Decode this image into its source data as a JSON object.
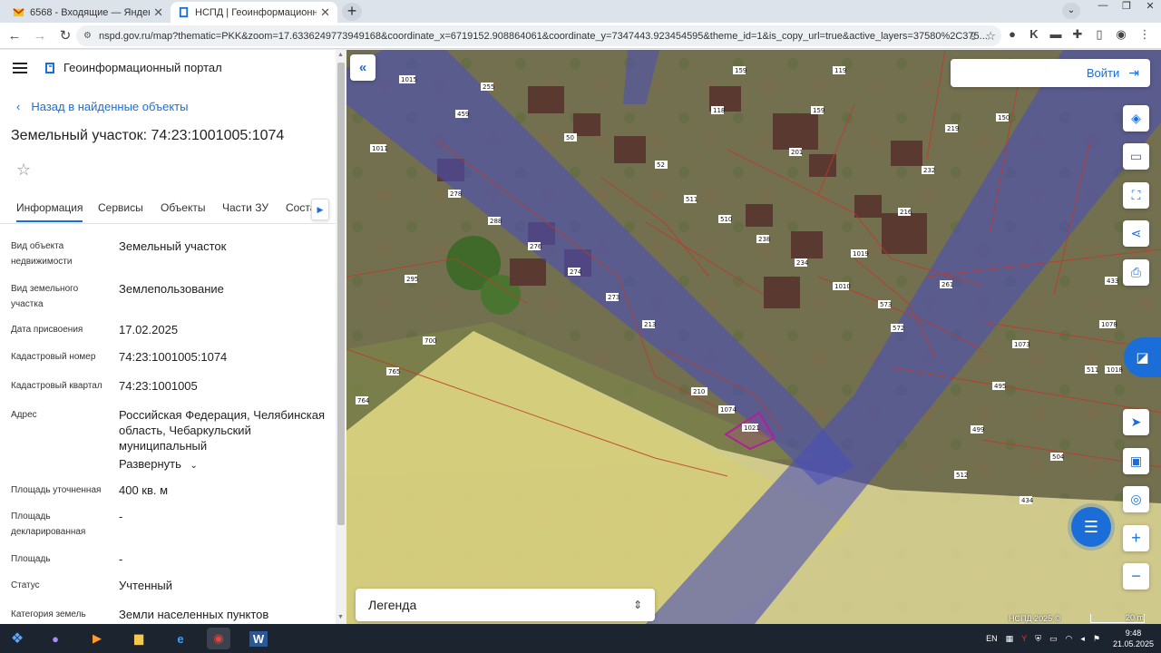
{
  "browser": {
    "tabs": [
      {
        "title": "6568 - Входящие — Яндекс Почта",
        "active": false
      },
      {
        "title": "НСПД | Геоинформационный портал",
        "active": true
      }
    ],
    "url": "nspd.gov.ru/map?thematic=PKK&zoom=17.6336249773949168&coordinate_x=6719152.908864061&coordinate_y=7347443.923454595&theme_id=1&is_copy_url=true&active_layers=37580%2C375..."
  },
  "portal": {
    "name": "Геоинформационный портал",
    "back_label": "Назад в найденные объекты",
    "object_title": "Земельный участок: 74:23:1001005:1074",
    "tabs": [
      "Информация",
      "Сервисы",
      "Объекты",
      "Части ЗУ",
      "Соста"
    ],
    "properties": [
      {
        "key": "Вид объекта недвижимости",
        "value": "Земельный участок"
      },
      {
        "key": "Вид земельного участка",
        "value": "Землепользование"
      },
      {
        "key": "Дата присвоения",
        "value": "17.02.2025"
      },
      {
        "key": "Кадастровый номер",
        "value": "74:23:1001005:1074"
      },
      {
        "key": "Кадастровый квартал",
        "value": "74:23:1001005"
      },
      {
        "key": "Адрес",
        "value": "Российская Федерация, Челябинская область, Чебаркульский муниципальный"
      },
      {
        "key": "Площадь уточненная",
        "value": "400 кв. м"
      },
      {
        "key": "Площадь декларированная",
        "value": "-"
      },
      {
        "key": "Площадь",
        "value": "-"
      },
      {
        "key": "Статус",
        "value": "Учтенный"
      },
      {
        "key": "Категория земель",
        "value": "Земли населенных пунктов"
      }
    ],
    "expand_label": "Развернуть"
  },
  "map": {
    "login_label": "Войти",
    "legend_label": "Легенда",
    "copyright": "НСПД 2025 ©",
    "scale_label": "20 m",
    "parcel_labels": [
      "1015",
      "459",
      "255",
      "1011",
      "159",
      "119",
      "150",
      "210",
      "1074",
      "1021",
      "278",
      "276",
      "274",
      "273",
      "288",
      "295",
      "700",
      "765",
      "764",
      "1019",
      "1010",
      "572",
      "573",
      "512",
      "1073",
      "1078",
      "495",
      "499",
      "504",
      "511",
      "434",
      "433",
      "219",
      "232",
      "216",
      "261",
      "201",
      "159",
      "118",
      "50",
      "52",
      "511",
      "510",
      "238",
      "234",
      "213",
      "1018"
    ],
    "colors": {
      "accent": "#1b6ed8",
      "blue_zone": "#4a4fb8",
      "yellow_zone": "#f3ecb0",
      "parcel_highlight": "#b0209a"
    }
  },
  "taskbar": {
    "lang": "EN",
    "time": "9:48",
    "date": "21.05.2025"
  }
}
